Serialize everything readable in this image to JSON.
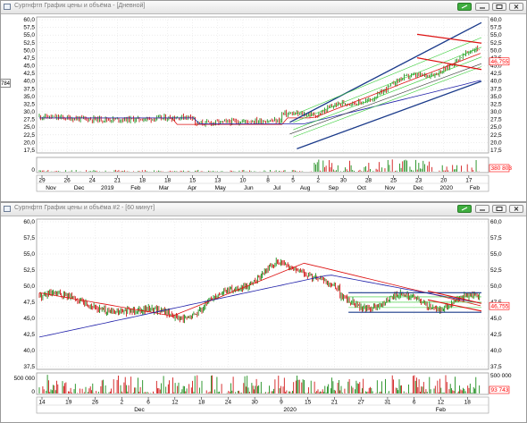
{
  "window1": {
    "title": "Сургнфтп График цены и объёма - [Дневной]",
    "side_label": "784",
    "price_axis": [
      "60,0",
      "57,5",
      "55,0",
      "52,5",
      "50,0",
      "47,5",
      "45,0",
      "42,5",
      "40,0",
      "37,5",
      "35,0",
      "32,5",
      "30,0",
      "27,5",
      "25,0",
      "22,5",
      "20,0",
      "17,5"
    ],
    "price_axis_right": [
      "60,0",
      "57,5",
      "55,0",
      "52,5",
      "50,0",
      "47,5",
      "45,0",
      "42,5",
      "40,0",
      "37,5",
      "35,0",
      "32,5",
      "30,0",
      "27,5",
      "25,0",
      "22,5",
      "20,0",
      "17,5"
    ],
    "current_price": "46,755",
    "volume_axis_left": "0",
    "volume_badge": "380 803",
    "date_top": [
      "29",
      "26",
      "24",
      "21",
      "18",
      "18",
      "15",
      "13",
      "10",
      "8",
      "5",
      "2",
      "30",
      "28",
      "25",
      "23",
      "20",
      "17"
    ],
    "date_bottom": [
      "Nov",
      "Dec",
      "2019",
      "Feb",
      "Mar",
      "Apr",
      "May",
      "Jun",
      "Jul",
      "Aug",
      "Sep",
      "Oct",
      "Nov",
      "Dec",
      "2020",
      "Feb"
    ]
  },
  "window2": {
    "title": "Сургнфтп График цены и объёма #2 - [60 минут]",
    "price_axis": [
      "60,0",
      "57,5",
      "55,0",
      "52,5",
      "50,0",
      "47,5",
      "45,0",
      "42,5",
      "40,0",
      "37,5"
    ],
    "price_axis_right": [
      "60,0",
      "57,5",
      "55,0",
      "52,5",
      "50,0",
      "47,5",
      "45,0",
      "42,5",
      "40,0",
      "37,5"
    ],
    "current_price": "46,755",
    "volume_axis_left": [
      "500 000",
      "0"
    ],
    "volume_axis_right": "500 000",
    "volume_badge": "93 743",
    "date_top": [
      "14",
      "19",
      "26",
      "2",
      "6",
      "12",
      "18",
      "24",
      "30",
      "9",
      "15",
      "21",
      "27",
      "31",
      "6",
      "12",
      "18"
    ],
    "date_bottom": [
      "Dec",
      "2020",
      "Feb"
    ]
  },
  "colors": {
    "price_up": "#007f00",
    "price_down": "#cc0000",
    "channel": "#1a3a8a",
    "ma_red": "#dd1111",
    "ma_blue": "#2222aa",
    "fib_green": "#33cc33",
    "badge": "#ff0000",
    "window_bg": "#d4d0c8"
  },
  "icons": {
    "link": "link-icon",
    "minimize": "minimize-icon",
    "maximize": "maximize-icon",
    "close": "close-icon",
    "window": "chart-window-icon"
  }
}
